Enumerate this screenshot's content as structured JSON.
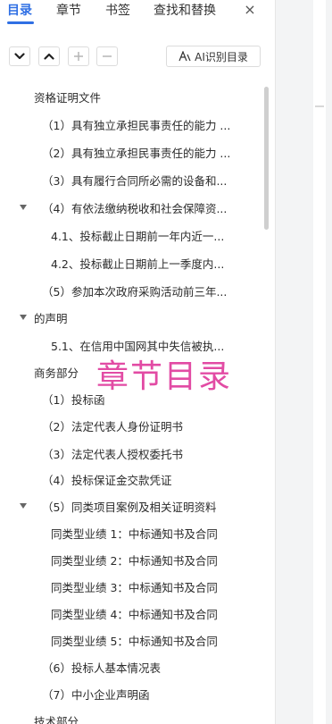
{
  "tabs": [
    "目录",
    "章节",
    "书签",
    "查找和替换"
  ],
  "close_glyph": "×",
  "toolbar": {
    "collapse_icon": "chevron-down-icon",
    "expand_icon": "chevron-up-icon",
    "add_icon": "plus-icon",
    "remove_icon": "minus-icon",
    "ai_label": "AI识别目录"
  },
  "toc": [
    "资格证明文件",
    "（1）具有独立承担民事责任的能力 ...",
    "（2）具有独立承担民事责任的能力 ...",
    "（3）具有履行合同所必需的设备和...",
    "（4）有依法缴纳税收和社会保障资...",
    "4.1、投标截止日期前一年内近一...",
    "4.2、投标截止日期前上一季度内...",
    "（5）参加本次政府采购活动前三年...",
    "的声明",
    "5.1、在信用中国网其中失信被执...",
    "商务部分",
    "（1）投标函",
    "（2）法定代表人身份证明书",
    "（3）法定代表人授权委托书",
    "（4）投标保证金交款凭证",
    "（5）同类项目案例及相关证明资料",
    "同类型业绩 1：中标通知书及合同",
    "同类型业绩 2：中标通知书及合同",
    "同类型业绩 3：中标通知书及合同",
    "同类型业绩 4：中标通知书及合同",
    "同类型业绩 5：中标通知书及合同",
    "（6）投标人基本情况表",
    "（7）中小企业声明函",
    "技术部分"
  ],
  "overlay_text": "章节目录",
  "colors": {
    "accent": "#2f6fe4",
    "overlay": "#e24ba4"
  }
}
